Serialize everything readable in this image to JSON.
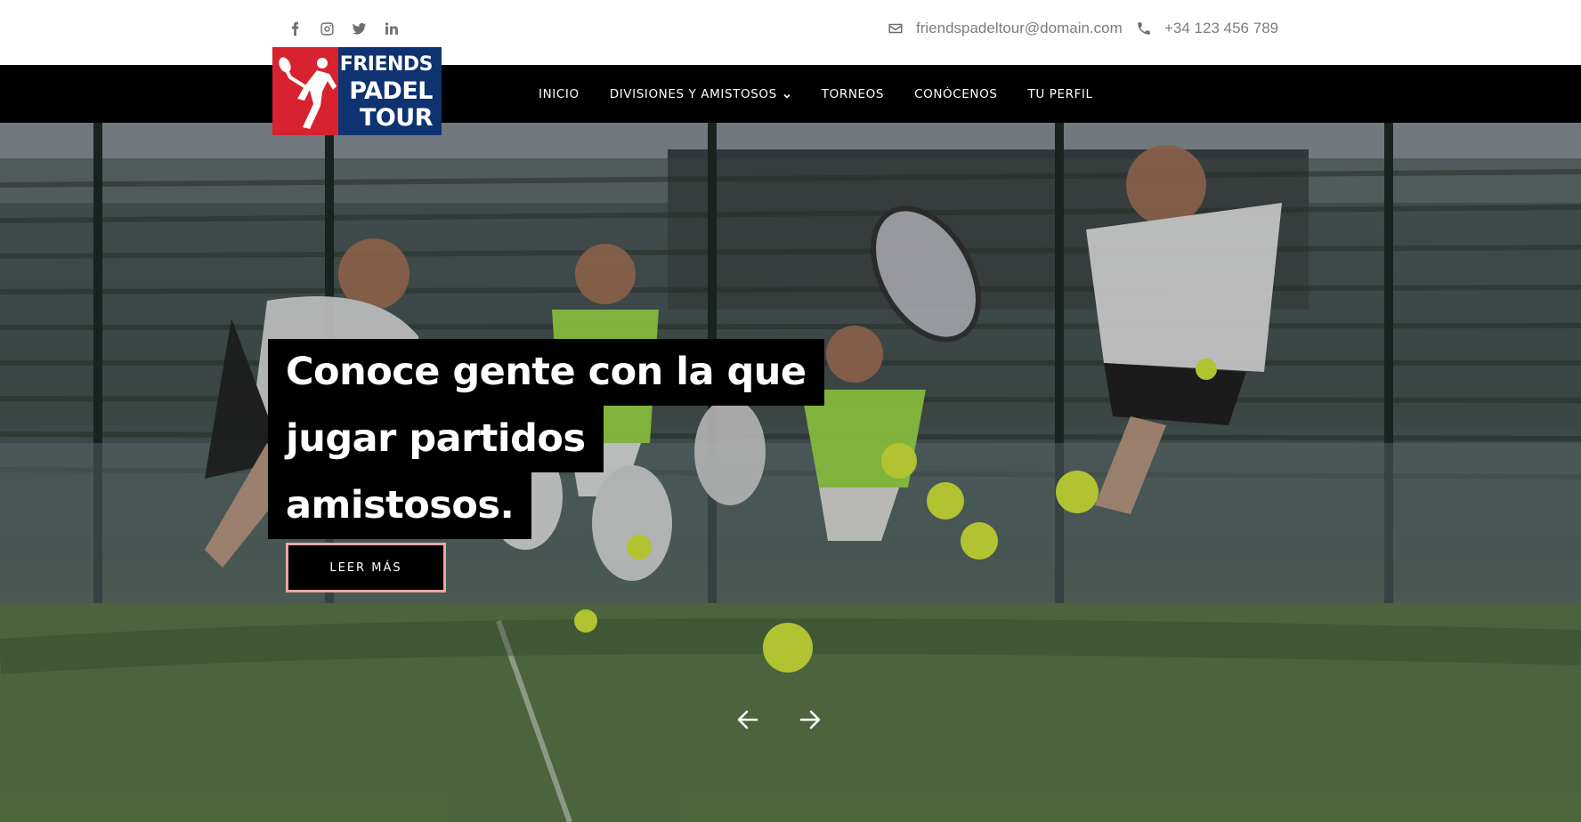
{
  "topbar": {
    "social": [
      {
        "name": "facebook-icon",
        "glyph": "f"
      },
      {
        "name": "instagram-icon",
        "glyph": "ig"
      },
      {
        "name": "twitter-icon",
        "glyph": "tw"
      },
      {
        "name": "linkedin-icon",
        "glyph": "in"
      }
    ],
    "email": "friendspadeltour@domain.com",
    "phone": "+34 123 456 789"
  },
  "logo": {
    "line1": "FRIENDS",
    "line2": "PADEL",
    "line3": "TOUR",
    "colors": {
      "blue": "#0f3370",
      "red": "#d8222f"
    }
  },
  "nav": {
    "items": [
      {
        "label": "INICIO"
      },
      {
        "label": "DIVISIONES Y AMISTOSOS",
        "has_dropdown": true
      },
      {
        "label": "TORNEOS"
      },
      {
        "label": "CONÓCENOS"
      },
      {
        "label": "TU PERFIL"
      }
    ]
  },
  "hero": {
    "headline_lines": [
      "Conoce gente con la que",
      "jugar partidos",
      "amistosos."
    ],
    "cta_label": "LEER MÁS",
    "cta_border_color": "#e9a6a7",
    "prev_icon": "arrow-left-icon",
    "next_icon": "arrow-right-icon"
  }
}
